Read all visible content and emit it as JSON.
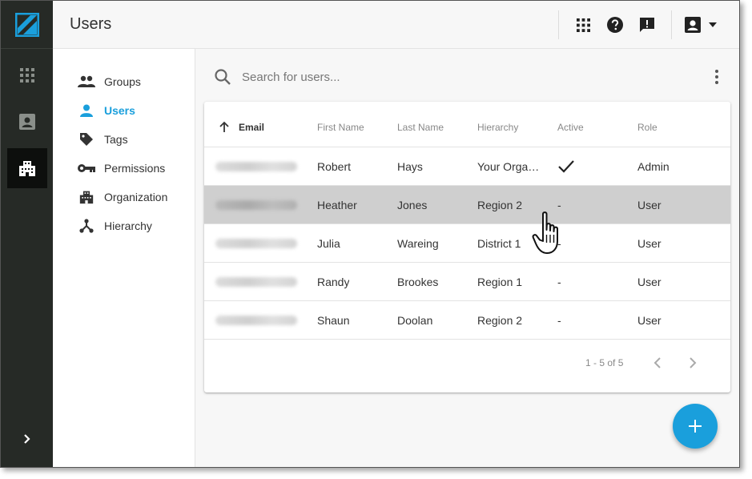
{
  "header": {
    "title": "Users"
  },
  "icons": {
    "logo": "slash-logo-icon",
    "apps": "apps-grid-icon",
    "help": "help-icon",
    "feedback": "feedback-icon",
    "account": "account-box-icon",
    "account_menu": "caret-down-icon"
  },
  "colors": {
    "accent": "#1a9fdc",
    "rail": "#262a26",
    "row_hover": "#cfcfcf"
  },
  "subnav": {
    "items": [
      {
        "label": "Groups",
        "icon": "people-icon",
        "active": false
      },
      {
        "label": "Users",
        "icon": "person-icon",
        "active": true
      },
      {
        "label": "Tags",
        "icon": "tag-icon",
        "active": false
      },
      {
        "label": "Permissions",
        "icon": "key-icon",
        "active": false
      },
      {
        "label": "Organization",
        "icon": "building-icon",
        "active": false
      },
      {
        "label": "Hierarchy",
        "icon": "hierarchy-icon",
        "active": false
      }
    ]
  },
  "search": {
    "placeholder": "Search for users...",
    "value": ""
  },
  "table": {
    "columns": [
      "Email",
      "First Name",
      "Last Name",
      "Hierarchy",
      "Active",
      "Role"
    ],
    "sorted_column": "Email",
    "sort_direction": "ascending",
    "rows": [
      {
        "first_name": "Robert",
        "last_name": "Hays",
        "hierarchy": "Your Orga…",
        "active": "✓",
        "role": "Admin"
      },
      {
        "first_name": "Heather",
        "last_name": "Jones",
        "hierarchy": "Region 2",
        "active": "-",
        "role": "User"
      },
      {
        "first_name": "Julia",
        "last_name": "Wareing",
        "hierarchy": "District 1",
        "active": "-",
        "role": "User"
      },
      {
        "first_name": "Randy",
        "last_name": "Brookes",
        "hierarchy": "Region 1",
        "active": "-",
        "role": "User"
      },
      {
        "first_name": "Shaun",
        "last_name": "Doolan",
        "hierarchy": "Region 2",
        "active": "-",
        "role": "User"
      }
    ],
    "hovered_row": 1
  },
  "pagination": {
    "range_text": "1 - 5 of 5"
  },
  "fab": {
    "icon": "plus-icon"
  }
}
